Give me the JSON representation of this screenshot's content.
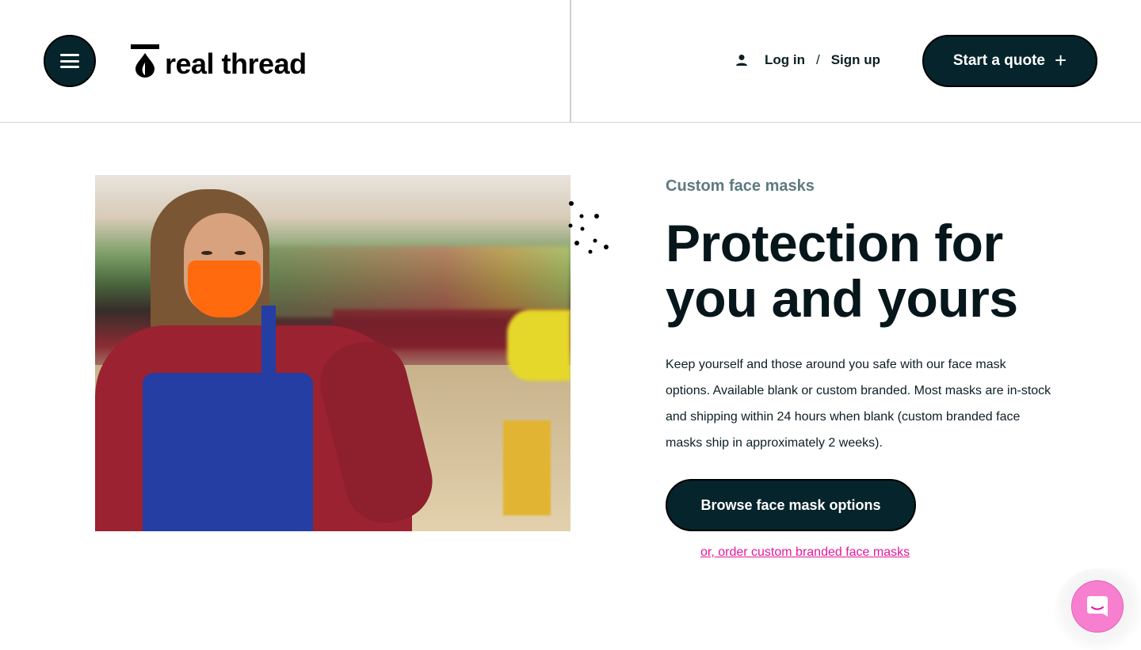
{
  "header": {
    "menu_icon": "hamburger-menu-icon",
    "logo": {
      "icon": "thread-drop-icon",
      "text": "real thread"
    },
    "auth": {
      "user_icon": "user-icon",
      "login_label": "Log in",
      "separator": "/",
      "signup_label": "Sign up"
    },
    "cta": {
      "label": "Start a quote",
      "icon": "+"
    }
  },
  "hero": {
    "image": {
      "description": "Woman wearing an orange face mask, red long-sleeve shirt and blue apron standing in a grocery store produce aisle"
    },
    "decoration_icon": "dots-icon",
    "eyebrow": "Custom face masks",
    "headline": "Protection for you and yours",
    "body": "Keep yourself and those around you safe with our face mask options. Available blank or custom branded. Most masks are in-stock and shipping within 24 hours when blank (custom branded face masks ship in approximately 2 weeks).",
    "primary_button": "Browse face mask options",
    "secondary_link": "or, order custom branded face masks"
  },
  "chat_widget": {
    "icon": "chat-smile-icon"
  },
  "colors": {
    "primary_dark": "#06242b",
    "eyebrow": "#5e7a80",
    "link_pink": "#e5179b",
    "chat_pink": "#f77fcf",
    "divider": "#d4d4d4"
  }
}
